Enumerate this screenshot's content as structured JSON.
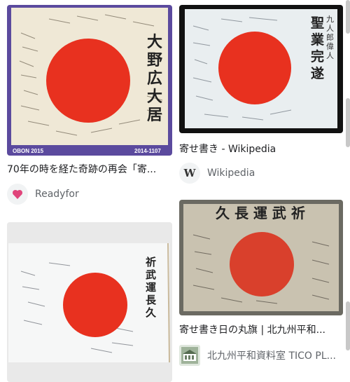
{
  "results": [
    {
      "title": "70年の時を経た奇跡の再会「寄...",
      "source": "Readyfor",
      "favicon": "readyfor-icon",
      "image": "hinomaru-yosegaki-flag",
      "image_labels": {
        "left": "OBON 2015",
        "right": "2014-1107"
      },
      "flag_text": "大野広大居"
    },
    {
      "title": "寄せ書き - Wikipedia",
      "source": "Wikipedia",
      "favicon": "wikipedia-icon",
      "image": "hinomaru-yosegaki-flag",
      "flag_text": "聖業完遂"
    },
    {
      "title": "",
      "source": "",
      "image": "hinomaru-yosegaki-flag",
      "flag_text": "武運長久"
    },
    {
      "title": "寄せ書き日の丸旗 | 北九州平和...",
      "source": "北九州平和資料室 TICO PL...",
      "favicon": "tico-icon",
      "image": "hinomaru-yosegaki-flag",
      "flag_text": "武運長久"
    }
  ],
  "favicon_letters": {
    "wikipedia": "W"
  },
  "colors": {
    "sun_red": "#e8311f",
    "flag_cloth": "#f3efe4",
    "frame_purple": "#5b4a9e",
    "text": "#202124",
    "muted": "#5f6368"
  }
}
